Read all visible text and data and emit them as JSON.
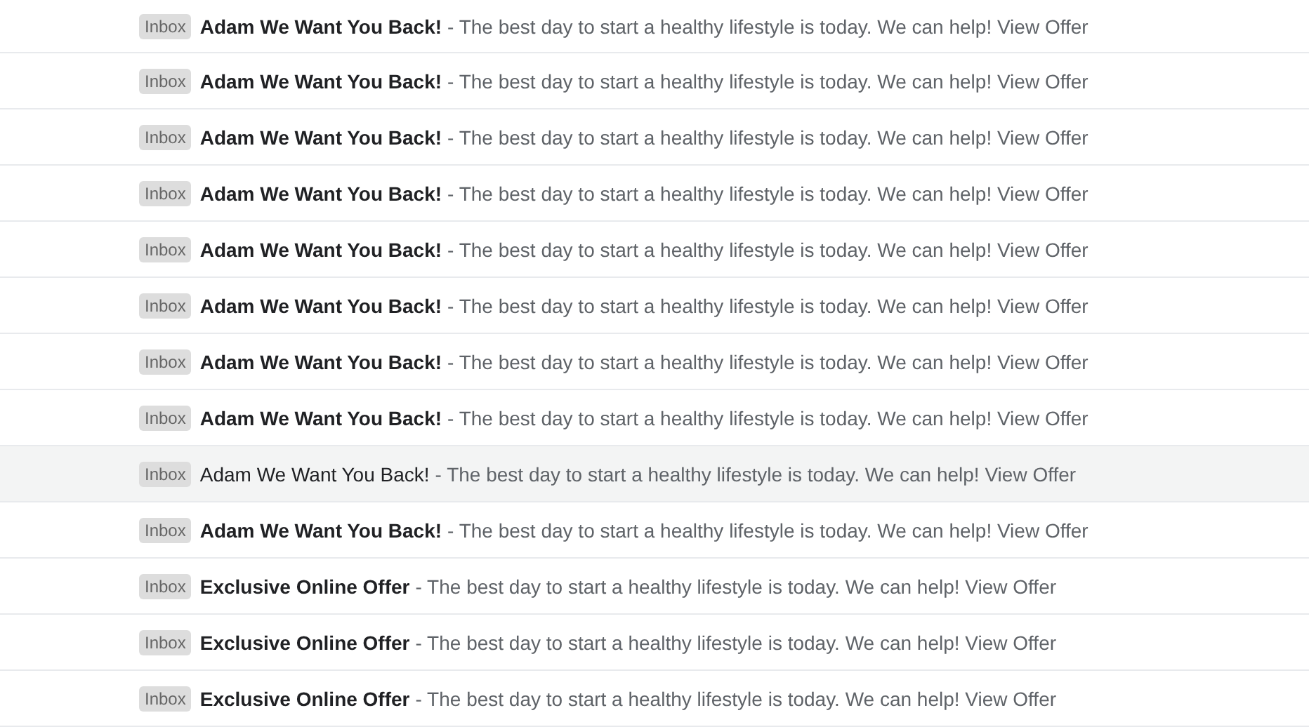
{
  "emails": [
    {
      "label": "Inbox",
      "subject": "Adam We Want You Back!",
      "snippet": "- The best day to start a healthy lifestyle is today. We can help! View Offer",
      "unread": true,
      "highlighted": false
    },
    {
      "label": "Inbox",
      "subject": "Adam We Want You Back!",
      "snippet": "- The best day to start a healthy lifestyle is today. We can help! View Offer",
      "unread": true,
      "highlighted": false
    },
    {
      "label": "Inbox",
      "subject": "Adam We Want You Back!",
      "snippet": "- The best day to start a healthy lifestyle is today. We can help! View Offer",
      "unread": true,
      "highlighted": false
    },
    {
      "label": "Inbox",
      "subject": "Adam We Want You Back!",
      "snippet": "- The best day to start a healthy lifestyle is today. We can help! View Offer",
      "unread": true,
      "highlighted": false
    },
    {
      "label": "Inbox",
      "subject": "Adam We Want You Back!",
      "snippet": "- The best day to start a healthy lifestyle is today. We can help! View Offer",
      "unread": true,
      "highlighted": false
    },
    {
      "label": "Inbox",
      "subject": "Adam We Want You Back!",
      "snippet": "- The best day to start a healthy lifestyle is today. We can help! View Offer",
      "unread": true,
      "highlighted": false
    },
    {
      "label": "Inbox",
      "subject": "Adam We Want You Back!",
      "snippet": "- The best day to start a healthy lifestyle is today. We can help! View Offer",
      "unread": true,
      "highlighted": false
    },
    {
      "label": "Inbox",
      "subject": "Adam We Want You Back!",
      "snippet": "- The best day to start a healthy lifestyle is today. We can help! View Offer",
      "unread": true,
      "highlighted": false
    },
    {
      "label": "Inbox",
      "subject": "Adam We Want You Back!",
      "snippet": "- The best day to start a healthy lifestyle is today. We can help! View Offer",
      "unread": false,
      "highlighted": true
    },
    {
      "label": "Inbox",
      "subject": "Adam We Want You Back!",
      "snippet": "- The best day to start a healthy lifestyle is today. We can help! View Offer",
      "unread": true,
      "highlighted": false
    },
    {
      "label": "Inbox",
      "subject": "Exclusive Online Offer",
      "snippet": "- The best day to start a healthy lifestyle is today. We can help! View Offer",
      "unread": true,
      "highlighted": false
    },
    {
      "label": "Inbox",
      "subject": "Exclusive Online Offer",
      "snippet": "- The best day to start a healthy lifestyle is today. We can help! View Offer",
      "unread": true,
      "highlighted": false
    },
    {
      "label": "Inbox",
      "subject": "Exclusive Online Offer",
      "snippet": "- The best day to start a healthy lifestyle is today. We can help! View Offer",
      "unread": true,
      "highlighted": false
    }
  ]
}
